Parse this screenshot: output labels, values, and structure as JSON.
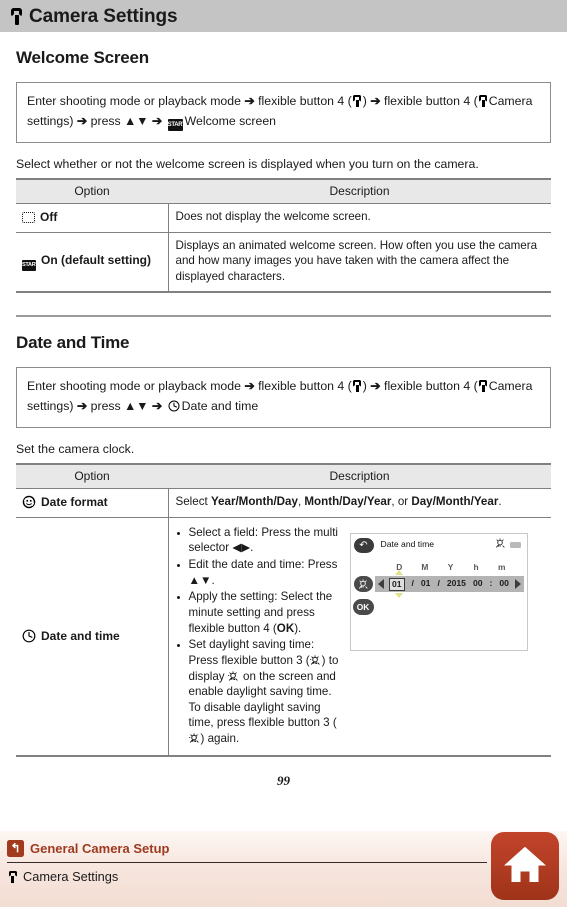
{
  "header": {
    "title": "Camera Settings",
    "icon": "wrench-icon"
  },
  "sections": [
    {
      "heading": "Welcome Screen",
      "path_box": {
        "line1_a": "Enter shooting mode or playback mode",
        "line1_b": "flexible button 4 (",
        "line1_c": ")",
        "line1_d": "flexible",
        "line2_a": "button 4 (",
        "line2_b": "Camera settings)",
        "line2_c": "press",
        "line2_d": "Welcome screen",
        "start_badge": "START",
        "arrow": "➔",
        "updown": "▲▼"
      },
      "intro": "Select whether or not the welcome screen is displayed when you turn on the camera.",
      "table": {
        "headers": [
          "Option",
          "Description"
        ],
        "rows": [
          {
            "icon": "off-frame-icon",
            "icon_label": "",
            "option": "Off",
            "description": "Does not display the welcome screen."
          },
          {
            "icon": "start-badge-icon",
            "icon_label": "START",
            "option": "On (default setting)",
            "description": "Displays an animated welcome screen. How often you use the camera and how many images you have taken with the camera affect the displayed characters."
          }
        ]
      }
    },
    {
      "heading": "Date and Time",
      "path_box": {
        "line1_a": "Enter shooting mode or playback mode",
        "line1_b": "flexible button 4 (",
        "line1_c": ")",
        "line1_d": "flexible",
        "line2_a": "button 4 (",
        "line2_b": "Camera settings)",
        "line2_c": "press",
        "line2_d": "Date and time",
        "arrow": "➔",
        "updown": "▲▼"
      },
      "intro": "Set the camera clock.",
      "table": {
        "headers": [
          "Option",
          "Description"
        ],
        "rows": [
          {
            "icon": "date-format-icon",
            "option": "Date format",
            "description_parts": [
              {
                "text": "Select ",
                "bold": false
              },
              {
                "text": "Year/Month/Day",
                "bold": true
              },
              {
                "text": ", ",
                "bold": false
              },
              {
                "text": "Month/Day/Year",
                "bold": true
              },
              {
                "text": ", or ",
                "bold": false
              },
              {
                "text": "Day/Month/Year",
                "bold": true
              },
              {
                "text": ".",
                "bold": false
              }
            ]
          },
          {
            "icon": "clock-icon",
            "option": "Date and time",
            "bullets": [
              {
                "parts": [
                  {
                    "text": "Select a field: Press the multi selector ",
                    "kind": "text"
                  },
                  {
                    "text": "◀▶",
                    "kind": "glyph"
                  },
                  {
                    "text": ".",
                    "kind": "text"
                  }
                ]
              },
              {
                "parts": [
                  {
                    "text": "Edit the date and time: Press ",
                    "kind": "text"
                  },
                  {
                    "text": "▲▼",
                    "kind": "glyph"
                  },
                  {
                    "text": ".",
                    "kind": "text"
                  }
                ]
              },
              {
                "parts": [
                  {
                    "text": "Apply the setting: Select the minute setting and press flexible button 4 (",
                    "kind": "text"
                  },
                  {
                    "text": "OK",
                    "kind": "bold"
                  },
                  {
                    "text": ").",
                    "kind": "text"
                  }
                ]
              },
              {
                "parts": [
                  {
                    "text": "Set daylight saving time: Press flexible button 3 (",
                    "kind": "text"
                  },
                  {
                    "text": "sun-icon",
                    "kind": "icon"
                  },
                  {
                    "text": ") to display ",
                    "kind": "text"
                  },
                  {
                    "text": "sun-icon",
                    "kind": "icon"
                  },
                  {
                    "text": " on the screen and enable daylight saving time. To disable daylight saving time, press flexible button 3 (",
                    "kind": "text"
                  },
                  {
                    "text": "sun-icon",
                    "kind": "icon"
                  },
                  {
                    "text": ") again.",
                    "kind": "text"
                  }
                ]
              }
            ]
          }
        ]
      }
    }
  ],
  "camera_screen": {
    "back_glyph": "↶",
    "title": "Date and time",
    "dst_icon": "daylight-saving-icon",
    "battery_icon": "battery-icon",
    "column_labels": [
      "D",
      "M",
      "Y",
      "h",
      "m"
    ],
    "values": {
      "day": "01",
      "sep1": "/",
      "month": "01",
      "sep2": "/",
      "year": "2015",
      "hour": "00",
      "colon": ":",
      "minute": "00"
    },
    "ok_label": "OK",
    "left_arrow": "◀",
    "right_arrow": "▶"
  },
  "page_number": "99",
  "footer": {
    "breadcrumb_primary": "General Camera Setup",
    "breadcrumb_primary_icon": "back-arrow-icon",
    "breadcrumb_secondary": "Camera Settings",
    "breadcrumb_secondary_icon": "wrench-icon",
    "home_button_icon": "home-icon",
    "accent_color": "#9e3a20",
    "home_button_color": "#b33d24"
  }
}
